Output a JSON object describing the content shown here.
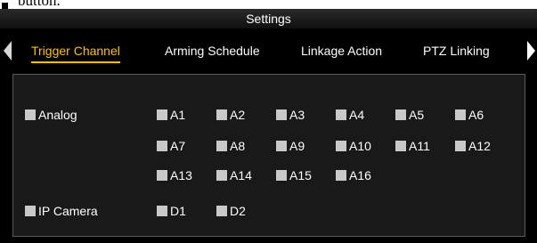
{
  "caption": {
    "text": "button."
  },
  "dialog": {
    "title": "Settings",
    "tabs": [
      {
        "label": "Trigger Channel",
        "active": true
      },
      {
        "label": "Arming Schedule",
        "active": false
      },
      {
        "label": "Linkage Action",
        "active": false
      },
      {
        "label": "PTZ Linking",
        "active": false
      }
    ]
  },
  "analog": {
    "label": "Analog",
    "channels": [
      "A1",
      "A2",
      "A3",
      "A4",
      "A5",
      "A6",
      "A7",
      "A8",
      "A9",
      "A10",
      "A11",
      "A12",
      "A13",
      "A14",
      "A15",
      "A16"
    ]
  },
  "ip_camera": {
    "label": "IP Camera",
    "channels": [
      "D1",
      "D2"
    ]
  },
  "colors": {
    "active_tab": "#ffc000",
    "background": "#000000",
    "panel": "#191919",
    "checkbox": "#c9c9c9"
  },
  "icons": [
    "tab-scroll-left-icon",
    "tab-scroll-right-icon"
  ]
}
